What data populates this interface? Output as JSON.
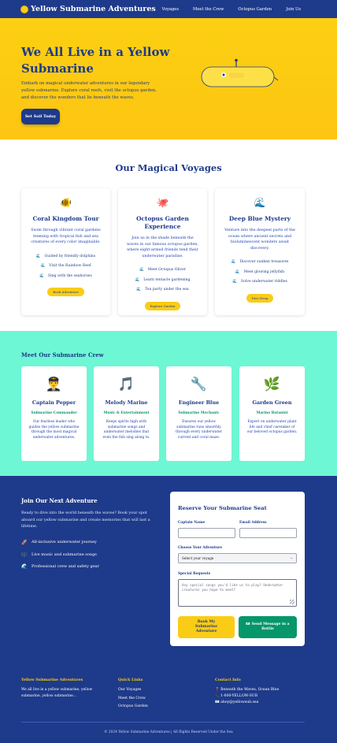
{
  "header": {
    "brand": "Yellow Submarine Adventures",
    "nav": [
      "Voyages",
      "Meet the Crew",
      "Octopus Garden",
      "Join Us"
    ]
  },
  "hero": {
    "title": "We All Live in a Yellow Submarine",
    "subtitle": "Embark on magical underwater adventures in our legendary yellow submarine. Explore coral reefs, visit the octopus garden, and discover the wonders that lie beneath the waves.",
    "cta": "Set Sail Today"
  },
  "voyages": {
    "title": "Our Magical Voyages",
    "cards": [
      {
        "icon": "🐠",
        "title": "Coral Kingdom Tour",
        "desc": "Swim through vibrant coral gardens teeming with tropical fish and sea creatures of every color imaginable.",
        "items": [
          "Guided by friendly dolphins",
          "Visit the Rainbow Reef",
          "Sing with the seahorses"
        ],
        "button": "Book Adventure"
      },
      {
        "icon": "🐙",
        "title": "Octopus Garden Experience",
        "desc": "Join us in the shade beneath the waves in our famous octopus garden, where eight-armed friends tend their underwater paradise.",
        "items": [
          "Meet Octopus Oliver",
          "Learn tentacle gardening",
          "Tea party under the sea"
        ],
        "button": "Explore Garden"
      },
      {
        "icon": "🌊",
        "title": "Deep Blue Mystery",
        "desc": "Venture into the deepest parts of the ocean where ancient secrets and bioluminescent wonders await discovery.",
        "items": [
          "Discover sunken treasures",
          "Meet glowing jellyfish",
          "Solve underwater riddles"
        ],
        "button": "Dive Deep"
      }
    ]
  },
  "crew": {
    "title": "Meet Our Submarine Crew",
    "members": [
      {
        "icon": "👨‍✈️",
        "name": "Captain Pepper",
        "role": "Submarine Commander",
        "desc": "Our fearless leader who guides the yellow submarine through the most magical underwater adventures."
      },
      {
        "icon": "🎵",
        "name": "Melody Marine",
        "role": "Music & Entertainment",
        "desc": "Keeps spirits high with submarine songs and underwater melodies that even the fish sing along to."
      },
      {
        "icon": "🔧",
        "name": "Engineer Blue",
        "role": "Submarine Mechanic",
        "desc": "Ensures our yellow submarine runs smoothly through every underwater current and coral maze."
      },
      {
        "icon": "🌿",
        "name": "Garden Green",
        "role": "Marine Botanist",
        "desc": "Expert on underwater plant life and chief caretaker of our beloved octopus garden."
      }
    ]
  },
  "adventure": {
    "title": "Join Our Next Adventure",
    "intro": "Ready to dive into the world beneath the waves? Book your spot aboard our yellow submarine and create memories that will last a lifetime.",
    "features": [
      {
        "icon": "🚀",
        "text": "All-inclusive underwater journey"
      },
      {
        "icon": "🎼",
        "text": "Live music and submarine songs"
      },
      {
        "icon": "🌊",
        "text": "Professional crew and safety gear"
      }
    ]
  },
  "form": {
    "title": "Reserve Your Submarine Seat",
    "name_label": "Captain Name",
    "name_value": "",
    "email_label": "Email Address",
    "email_value": "",
    "voyage_label": "Choose Your Adventure",
    "voyage_value": "Select your voyage",
    "requests_label": "Special Requests",
    "requests_placeholder": "Any special songs you'd like us to play? Underwater creatures you hope to meet?",
    "submit_label": "Book My Submarine Adventure",
    "bottle_label": "📧 Send Message in a Bottle"
  },
  "footer": {
    "col1_title": "Yellow Submarine Adventures",
    "col1_text": "We all live in a yellow submarine, yellow submarine, yellow submarine...",
    "col2_title": "Quick Links",
    "links": [
      "Our Voyages",
      "Meet the Crew",
      "Octopus Garden"
    ],
    "col3_title": "Contact Info",
    "contact": [
      "📍 Beneath the Waves, Ocean Blue",
      "📞 1-800-YELLOW-SUB",
      "📧 ahoy@yellowsub.sea"
    ],
    "copyright": "© 2024 Yellow Submarine Adventures | All Rights Reserved Under the Sea"
  },
  "colors": {
    "navy": "#1e3a8a",
    "yellow": "#facc15",
    "mint": "#6ef7d4",
    "green": "#059669"
  }
}
